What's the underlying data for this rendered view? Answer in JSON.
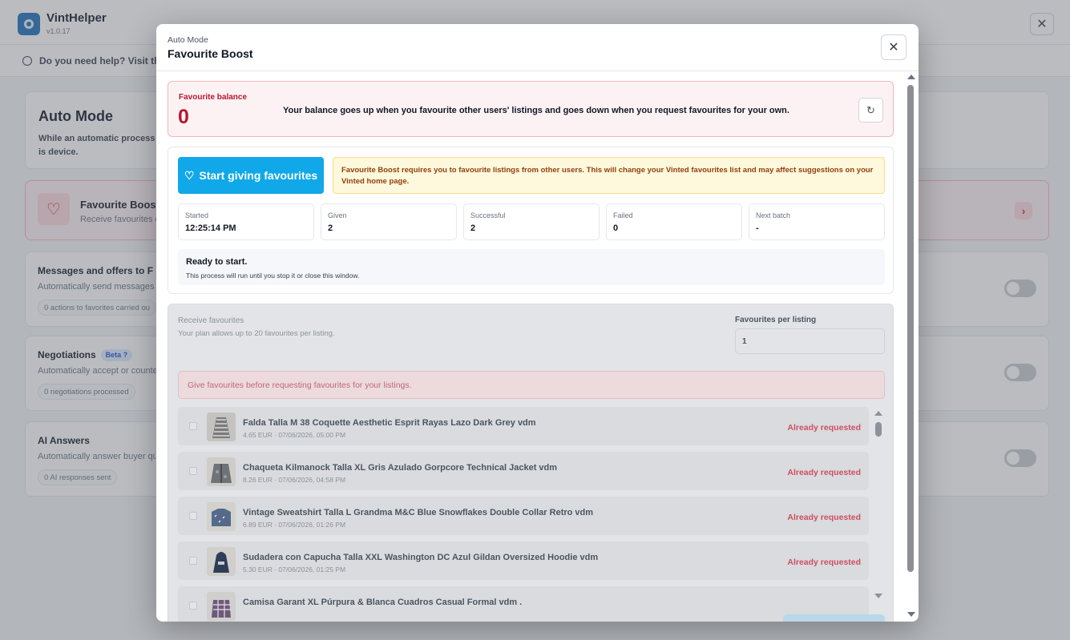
{
  "app": {
    "title": "VintHelper",
    "version": "v1.0.17",
    "close_label": "✕",
    "help_text": "Do you need help? Visit the d"
  },
  "background": {
    "auto_mode": {
      "title": "Auto Mode",
      "desc": "While an automatic process is device."
    },
    "favourite_boost": {
      "title": "Favourite Boost",
      "subtitle": "Receive favourites o"
    },
    "messages": {
      "title": "Messages and offers to F",
      "subtitle": "Automatically send messages a",
      "chip": "0 actions to favorites carried ou"
    },
    "negotiations": {
      "title": "Negotiations",
      "beta": "Beta ?",
      "subtitle": "Automatically accept or counte",
      "chip": "0 negotiations processed"
    },
    "ai_answers": {
      "title": "AI Answers",
      "subtitle": "Automatically answer buyer qu",
      "chip": "0 AI responses sent"
    }
  },
  "modal": {
    "subtitle": "Auto Mode",
    "title": "Favourite Boost",
    "close_label": "✕",
    "balance": {
      "label": "Favourite balance",
      "value": "0",
      "description": "Your balance goes up when you favourite other users' listings and goes down when you request favourites for your own.",
      "refresh_icon": "↻"
    },
    "give": {
      "start_button": "Start giving favourites",
      "warning": "Favourite Boost requires you to favourite listings from other users. This will change your Vinted favourites list and may affect suggestions on your Vinted home page.",
      "stats": [
        {
          "label": "Started",
          "value": "12:25:14 PM"
        },
        {
          "label": "Given",
          "value": "2"
        },
        {
          "label": "Successful",
          "value": "2"
        },
        {
          "label": "Failed",
          "value": "0"
        },
        {
          "label": "Next batch",
          "value": "-"
        }
      ],
      "status_title": "Ready to start.",
      "status_sub": "This process will run until you stop it or close this window."
    },
    "receive": {
      "title": "Receive favourites",
      "subtitle": "Your plan allows up to 20 favourites per listing.",
      "per_listing_label": "Favourites per listing",
      "per_listing_value": "1",
      "error": "Give favourites before requesting favourites for your listings.",
      "listings": [
        {
          "name": "Falda Talla M 38 Coquette Aesthetic Esprit Rayas Lazo Dark Grey vdm",
          "meta": "4.65 EUR · 07/06/2026, 05:00 PM",
          "status": "Already requested"
        },
        {
          "name": "Chaqueta Kilmanock Talla XL Gris Azulado Gorpcore Technical Jacket vdm",
          "meta": "8.26 EUR · 07/06/2026, 04:58 PM",
          "status": "Already requested"
        },
        {
          "name": "Vintage Sweatshirt Talla L Grandma M&C Blue Snowflakes Double Collar Retro vdm",
          "meta": "6.89 EUR · 07/06/2026, 01:26 PM",
          "status": "Already requested"
        },
        {
          "name": "Sudadera con Capucha Talla XXL Washington DC Azul Gildan Oversized Hoodie vdm",
          "meta": "5.30 EUR · 07/06/2026, 01:25 PM",
          "status": "Already requested"
        },
        {
          "name": "Camisa Garant XL Púrpura & Blanca Cuadros Casual Formal vdm .",
          "meta": "",
          "status": ""
        }
      ]
    }
  }
}
